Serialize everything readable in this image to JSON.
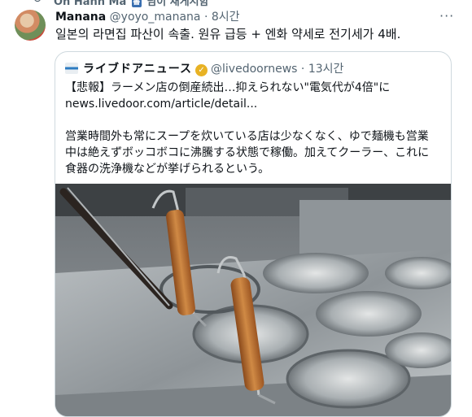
{
  "retweet_bar": {
    "icon": "retweet-icon",
    "prefix": "Oh Hanh Ma",
    "badge": "書",
    "suffix": "님이 재게시함"
  },
  "tweet": {
    "author_name": "Manana",
    "author_handle": "@yoyo_manana",
    "separator": "·",
    "time": "8시간",
    "more_icon": "more-icon",
    "more_label": "···",
    "text": "일본의 라면집 파산이 속출. 원유 급등 + 엔화 약세로 전기세가 4배."
  },
  "quoted": {
    "logo_icon": "livedoor-news-logo-icon",
    "source_name": "ライブドアニュース",
    "verified_icon": "verified-badge-icon",
    "verified_glyph": "✓",
    "handle": "@livedoornews",
    "separator": "·",
    "time": "13시간",
    "headline": "【悲報】ラーメン店の倒産続出…抑えられない\"電気代が4倍\"に",
    "link": "news.livedoor.com/article/detail...",
    "body_lines": [
      "営業時間外も常にスープを炊いている店は少なくなく、ゆで麺機も営業",
      "中は絶えずボッコボコに沸騰する状態で稼働。加えてクーラー、これに",
      "食器の洗浄機などが挙げられるという。"
    ],
    "image": "ramen-noodle-boiler-photo"
  }
}
